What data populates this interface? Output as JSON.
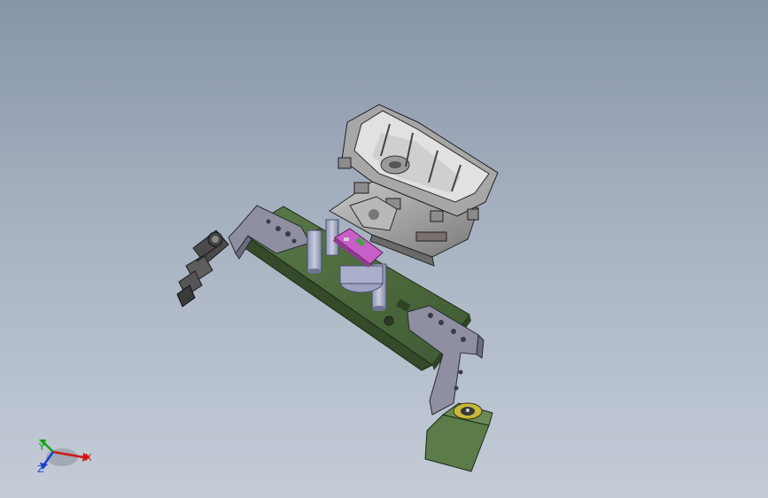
{
  "triad": {
    "x_label": "X",
    "y_label": "Y",
    "z_label": "Z"
  },
  "colors": {
    "background_top": "#8795a8",
    "background_bottom": "#c4ccd7",
    "base_plate": "#4e6b3f",
    "bracket": "#8c8d9d",
    "housing": "#9c9c9c",
    "pcb": "#c85ec8",
    "connector_block": "#5c7c4a",
    "axis_x": "#d01818",
    "axis_y": "#18a018",
    "axis_z": "#1a3fd0"
  }
}
